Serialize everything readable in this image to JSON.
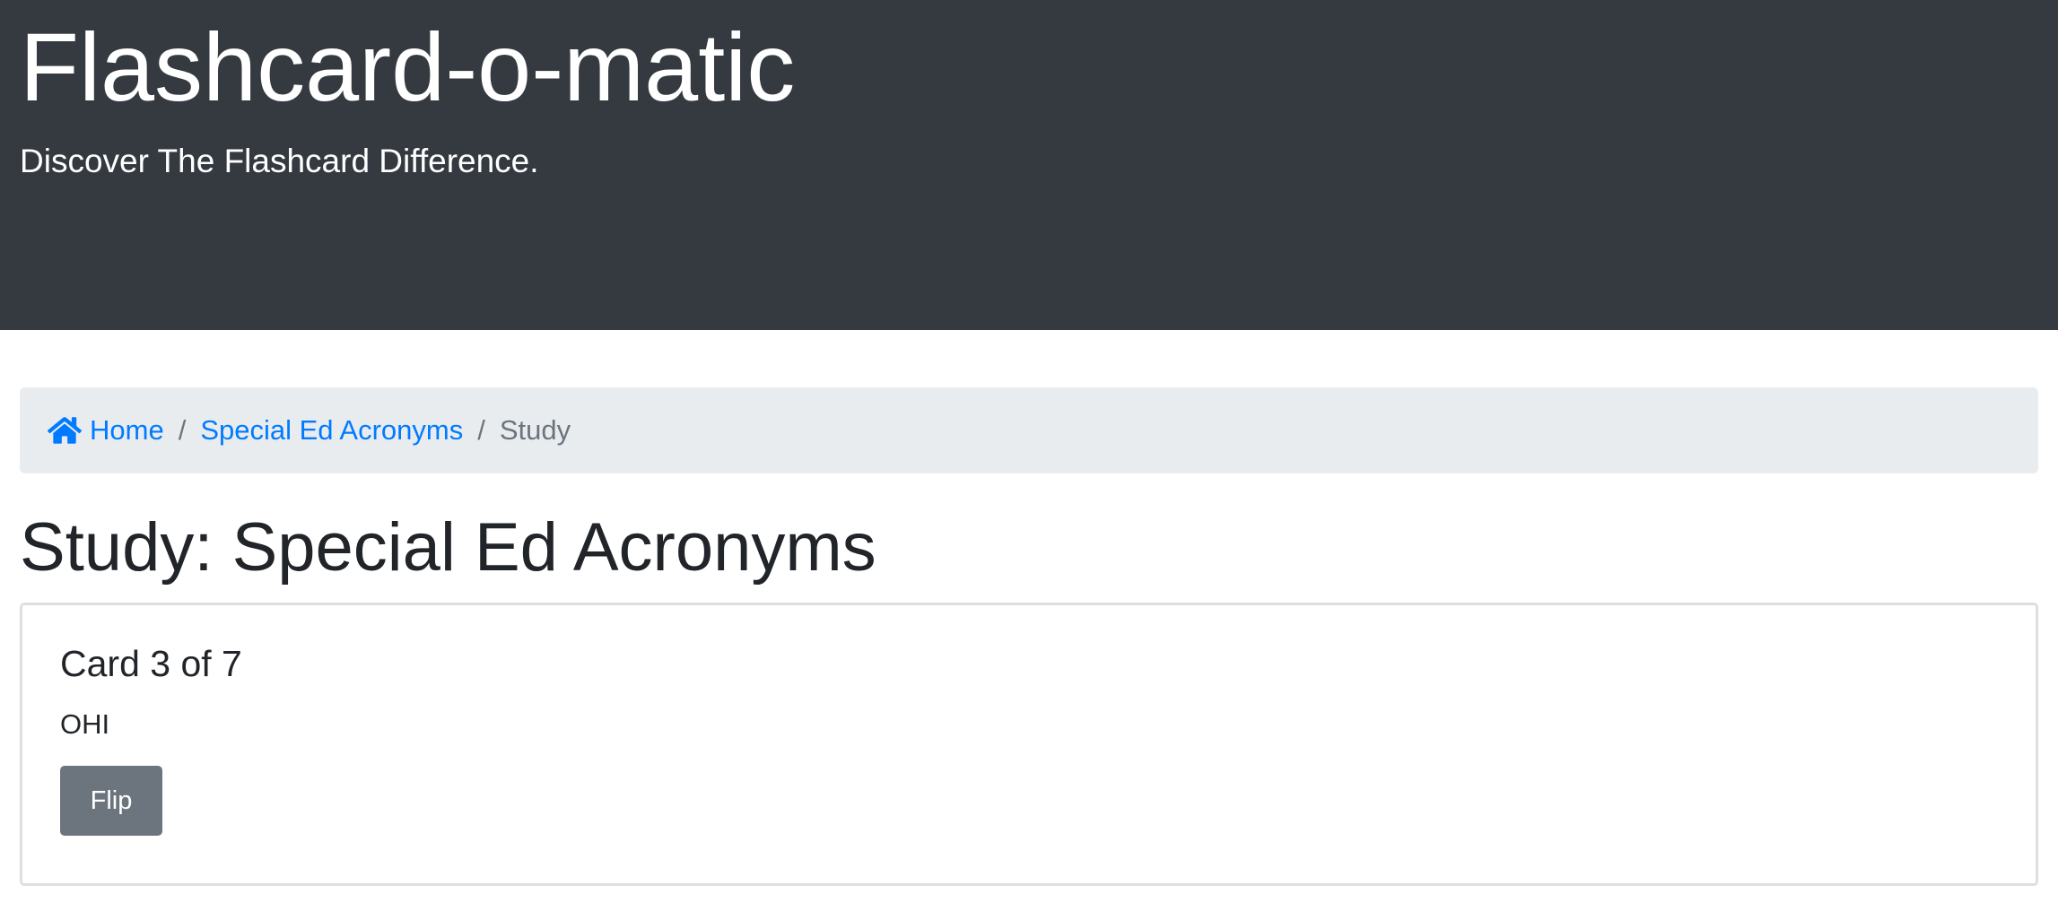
{
  "header": {
    "title": "Flashcard-o-matic",
    "subtitle": "Discover The Flashcard Difference."
  },
  "breadcrumb": {
    "home_icon": "home-icon",
    "home_label": "Home",
    "deck_label": "Special Ed Acronyms",
    "current_label": "Study",
    "separator": "/"
  },
  "colors": {
    "header_bg": "#343a40",
    "link": "#007bff",
    "breadcrumb_bg": "#e9ecef",
    "button_bg": "#6c757d"
  },
  "main": {
    "title": "Study: Special Ed Acronyms",
    "card": {
      "progress": "Card 3 of 7",
      "text": "OHI",
      "flip_label": "Flip"
    }
  }
}
